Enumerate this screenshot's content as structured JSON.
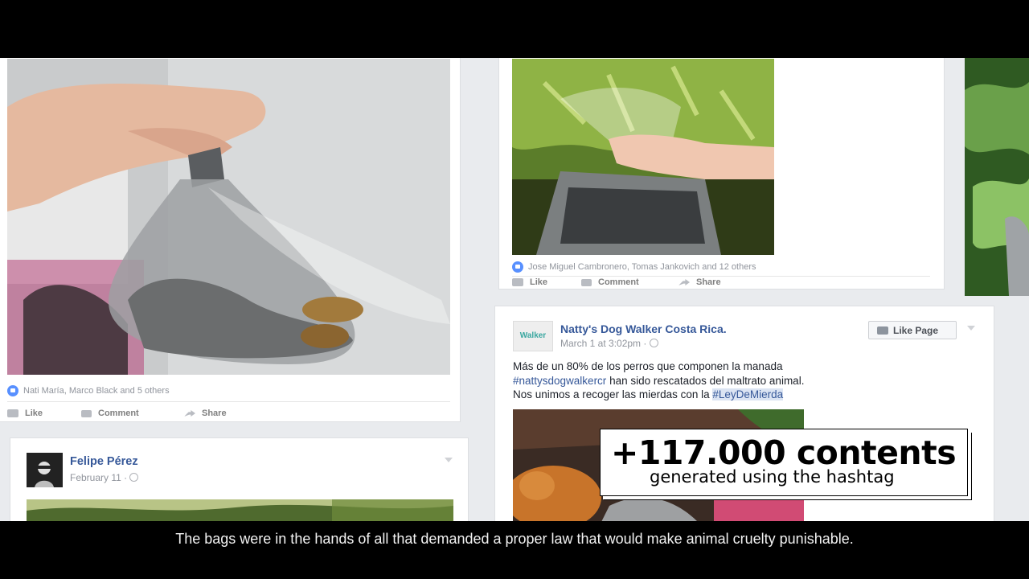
{
  "post_left": {
    "reactions_text": "Nati María, Marco Black and 5 others",
    "actions": [
      "Like",
      "Comment",
      "Share"
    ]
  },
  "post_felipe": {
    "author": "Felipe Pérez",
    "date": "February 11 · "
  },
  "post_middle_top": {
    "reactions_text": "Jose Miguel Cambronero, Tomas Jankovich and 12 others",
    "actions": [
      "Like",
      "Comment",
      "Share"
    ]
  },
  "post_natty": {
    "author": "Natty's Dog Walker Costa Rica.",
    "date": "March 1 at 3:02pm · ",
    "like_page_label": "Like Page",
    "text_line1": "Más de un 80% de los perros que componen la manada",
    "hashtag1": "#nattysdogwalkercr",
    "text_line2_rest": " han sido rescatados del maltrato animal.",
    "text_line3": "Nos unimos a recoger las mierdas con la ",
    "hashtag2": "#LeyDeMierda",
    "avatar_text": "Walker"
  },
  "stat": {
    "big": "+117.000 contents",
    "small": "generated using the hashtag"
  },
  "subtitle": "The bags were in the hands of all that demanded a proper law that would make animal cruelty punishable."
}
